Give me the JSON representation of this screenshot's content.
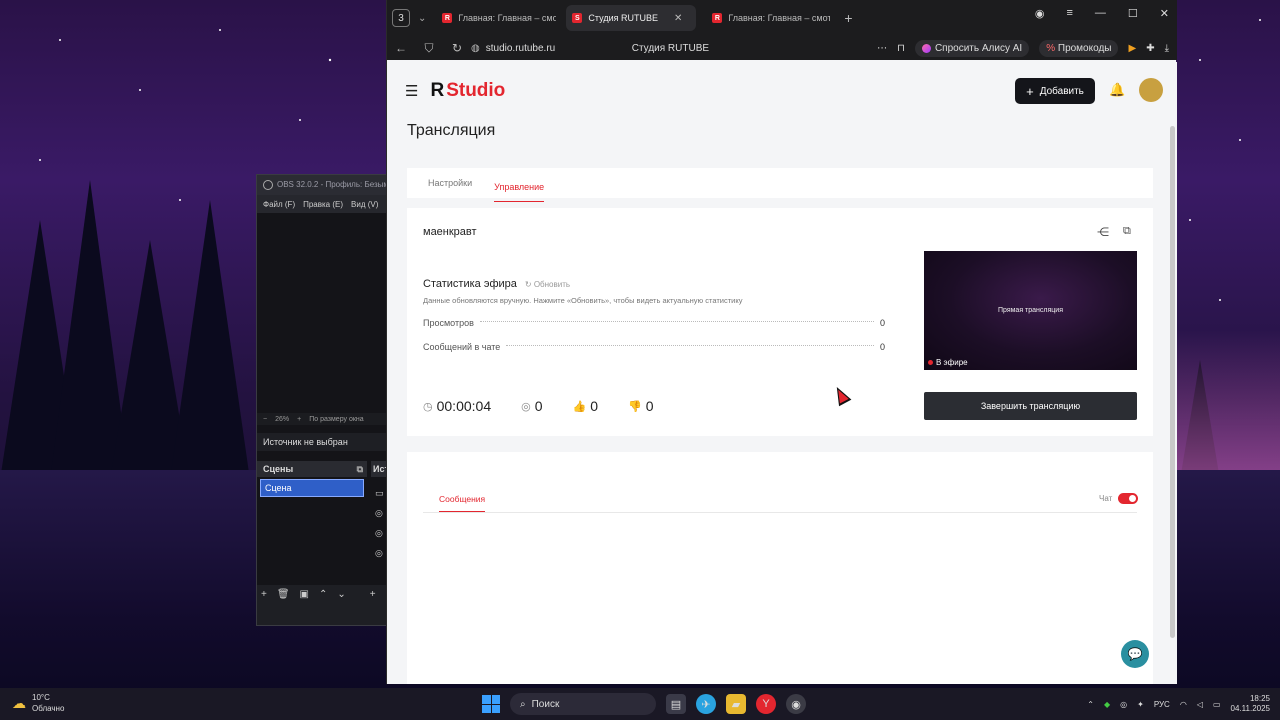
{
  "obs": {
    "title": "OBS 32.0.2 - Профиль: Безым",
    "menu": [
      "Файл (F)",
      "Правка (E)",
      "Вид (V)"
    ],
    "zoom_value": "26%",
    "zoom_mode": "По размеру окна",
    "source_label": "Источник не выбран",
    "scenes_header": "Сцены",
    "sources_header": "Ист",
    "scene_item": "Сцена",
    "tool_icons": [
      "plus-icon",
      "trash-icon",
      "filter-icon",
      "arrow-up-icon",
      "arrow-down-icon"
    ]
  },
  "browser": {
    "tab_count": "3",
    "tabs": [
      {
        "title": "Главная: Главная – смотр",
        "icon": "rutube-icon"
      },
      {
        "title": "Студия RUTUBE",
        "icon": "studio-icon",
        "active": true
      },
      {
        "title": "Главная: Главная – смотр",
        "icon": "rutube-icon"
      }
    ],
    "url": "studio.rutube.ru",
    "page_title": "Студия RUTUBE",
    "alice_label": "Спросить Алису AI",
    "promo_label": "Промокоды"
  },
  "app": {
    "logo_r": "R",
    "logo_studio": "Studio",
    "add_label": "Добавить",
    "page_heading": "Трансляция",
    "tabs": [
      {
        "label": "Настройки",
        "active": false
      },
      {
        "label": "Управление",
        "active": true
      }
    ],
    "stream_name": "маенкравт",
    "stats_title": "Статистика эфира",
    "refresh_label": "Обновить",
    "stats_hint": "Данные обновляются вручную. Нажмите «Обновить», чтобы видеть актуальную статистику",
    "stats": [
      {
        "label": "Просмотров",
        "value": "0"
      },
      {
        "label": "Сообщений в чате",
        "value": "0"
      }
    ],
    "duration": "00:00:04",
    "viewers": "0",
    "likes": "0",
    "dislikes": "0",
    "preview_text": "Прямая трансляция",
    "live_label": "В эфире",
    "end_button": "Завершить трансляцию",
    "messages_tab": "Сообщения",
    "chat_label": "Чат",
    "chat_enabled": true
  },
  "taskbar": {
    "temperature": "10°C",
    "weather": "Облачно",
    "search_placeholder": "Поиск",
    "language": "РУС",
    "time": "18:25",
    "date": "04.11.2025"
  },
  "colors": {
    "accent": "#e3262f",
    "dark_button": "#14151a",
    "page_bg": "#f4f5f7"
  }
}
